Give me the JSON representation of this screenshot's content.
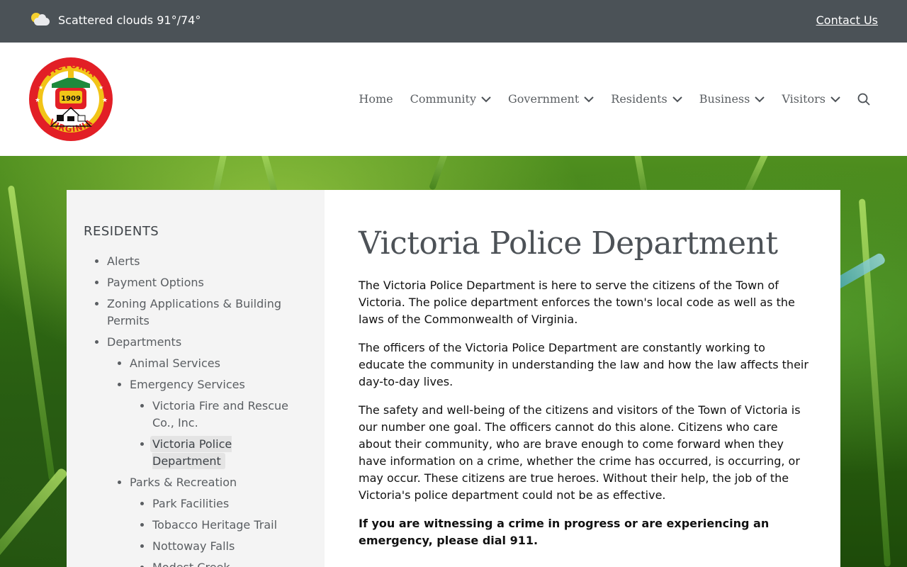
{
  "topbar": {
    "weather_icon": "partly-cloudy-icon",
    "weather_text": "Scattered clouds 91°/74°",
    "contact_label": "Contact Us"
  },
  "header": {
    "logo": {
      "top_text": "VICTORIA",
      "bottom_text": "VIRGINIA",
      "year": "1909",
      "colors": {
        "ring": "#e21f26",
        "band": "#f2c417",
        "engine": "#e21f26",
        "roof": "#1e8a3c"
      }
    },
    "nav": [
      {
        "label": "Home",
        "has_dropdown": false
      },
      {
        "label": "Community",
        "has_dropdown": true
      },
      {
        "label": "Government",
        "has_dropdown": true
      },
      {
        "label": "Residents",
        "has_dropdown": true
      },
      {
        "label": "Business",
        "has_dropdown": true
      },
      {
        "label": "Visitors",
        "has_dropdown": true
      }
    ],
    "search_icon": "search-icon"
  },
  "sidebar": {
    "title": "RESIDENTS",
    "items": {
      "alerts": "Alerts",
      "payment_options": "Payment Options",
      "zoning": "Zoning Applications & Building Permits",
      "departments": "Departments",
      "animal_services": "Animal Services",
      "emergency_services": "Emergency Services",
      "fire_rescue": "Victoria Fire and Rescue Co., Inc.",
      "police": "Victoria Police Department",
      "parks_recreation": "Parks & Recreation",
      "park_facilities": "Park Facilities",
      "tobacco_trail": "Tobacco Heritage Trail",
      "nottoway_falls": "Nottoway Falls",
      "modest_creek": "Modest Creek"
    },
    "active_item": "Victoria Police Department"
  },
  "main": {
    "title": "Victoria Police Department",
    "paragraphs": [
      "The Victoria Police Department is here to serve the citizens of the Town of Victoria.  The police department enforces the town's local code as well as the laws of the Commonwealth of Virginia.",
      "The officers of the Victoria Police Department are constantly working to educate the community in understanding the law and how the law affects their day-to-day lives.",
      "The safety and well-being of the citizens and visitors of the Town of Victoria is our number one goal.  The officers cannot do this alone. Citizens who care about their community, who are brave enough to come forward when they have information on a crime, whether the crime has occurred, is occurring, or may occur.  These citizens are true heroes.  Without their help, the job of the Victoria's police department could not be as effective."
    ],
    "emergency_notice": "If you are witnessing a crime in progress or are experiencing an emergency, please dial 911."
  }
}
